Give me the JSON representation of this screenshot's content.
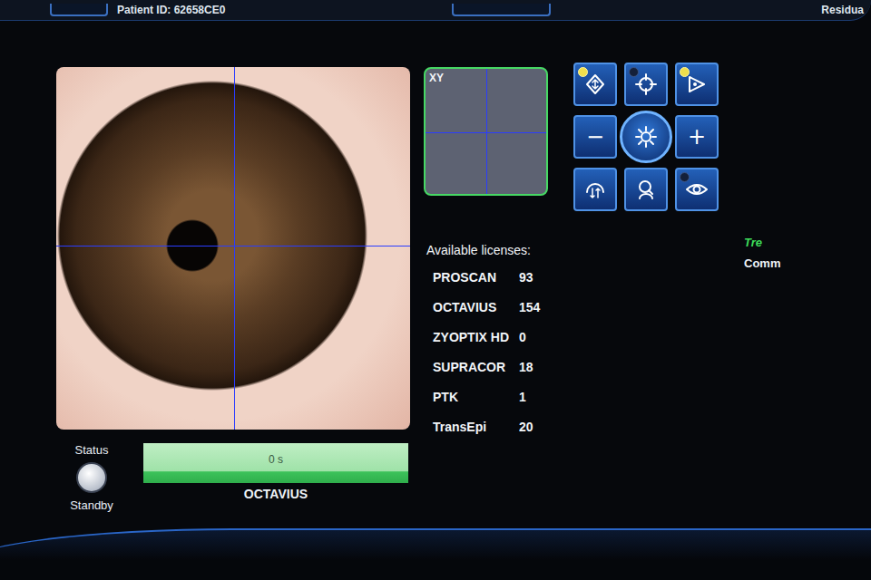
{
  "header": {
    "patient_id": "Patient ID: 62658CE0",
    "residual": "Residua"
  },
  "xy_panel": {
    "label": "XY"
  },
  "controls": [
    {
      "kind": "icon",
      "label": "",
      "indicator": true,
      "lit": true
    },
    {
      "kind": "icon",
      "label": "",
      "indicator": true,
      "lit": false
    },
    {
      "kind": "icon",
      "label": "",
      "indicator": true,
      "lit": true
    },
    {
      "kind": "text",
      "label": "−",
      "indicator": false,
      "lit": false
    },
    {
      "kind": "center",
      "label": "",
      "indicator": false,
      "lit": false
    },
    {
      "kind": "text",
      "label": "+",
      "indicator": false,
      "lit": false
    },
    {
      "kind": "icon",
      "label": "",
      "indicator": false,
      "lit": false
    },
    {
      "kind": "icon",
      "label": "",
      "indicator": false,
      "lit": false
    },
    {
      "kind": "icon",
      "label": "",
      "indicator": true,
      "lit": false
    }
  ],
  "licenses": {
    "title": "Available licenses:",
    "items": [
      {
        "name": "PROSCAN",
        "count": "93"
      },
      {
        "name": "OCTAVIUS",
        "count": "154"
      },
      {
        "name": "ZYOPTIX HD",
        "count": "0"
      },
      {
        "name": "SUPRACOR",
        "count": "18"
      },
      {
        "name": "PTK",
        "count": "1"
      },
      {
        "name": "TransEpi",
        "count": "20"
      }
    ]
  },
  "status": {
    "label": "Status",
    "state": "Standby"
  },
  "progress": {
    "reading": "0 s",
    "level": 1,
    "mode": "OCTAVIUS"
  },
  "treatment": {
    "title": "Tre",
    "comment": "Comm"
  }
}
